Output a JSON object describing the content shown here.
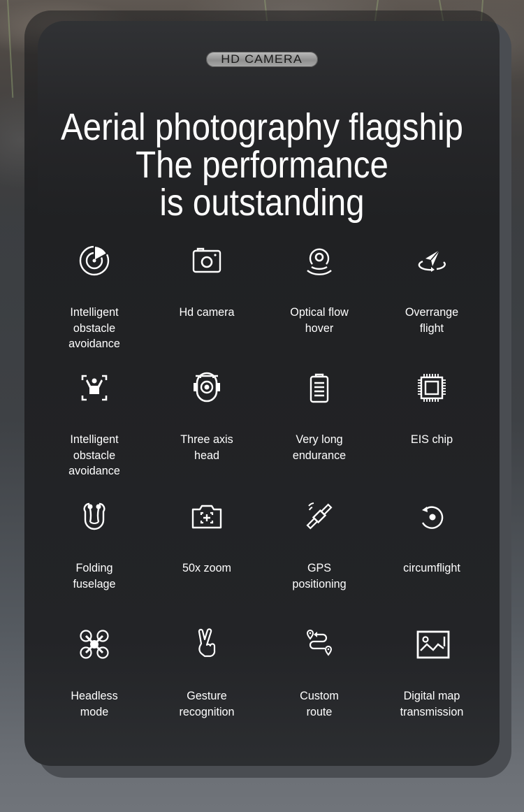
{
  "badge": {
    "label": "HD CAMERA"
  },
  "title": {
    "lines": [
      "Aerial photography flagship",
      "The performance",
      "is outstanding"
    ]
  },
  "features": [
    {
      "icon": "radar-icon",
      "label_lines": [
        "Intelligent",
        "obstacle",
        "avoidance"
      ]
    },
    {
      "icon": "camera-icon",
      "label_lines": [
        "Hd camera"
      ]
    },
    {
      "icon": "optical-flow-icon",
      "label_lines": [
        "Optical flow",
        "hover"
      ]
    },
    {
      "icon": "paper-plane-orbit-icon",
      "label_lines": [
        "Overrange",
        "flight"
      ]
    },
    {
      "icon": "person-scan-icon",
      "label_lines": [
        "Intelligent",
        "obstacle",
        "avoidance"
      ]
    },
    {
      "icon": "gimbal-camera-icon",
      "label_lines": [
        "Three axis",
        "head"
      ]
    },
    {
      "icon": "battery-icon",
      "label_lines": [
        "Very long",
        "endurance"
      ]
    },
    {
      "icon": "chip-icon",
      "label_lines": [
        "EIS chip"
      ]
    },
    {
      "icon": "folding-drone-icon",
      "label_lines": [
        "Folding",
        "fuselage"
      ]
    },
    {
      "icon": "zoom-camera-icon",
      "label_lines": [
        "50x zoom"
      ]
    },
    {
      "icon": "satellite-icon",
      "label_lines": [
        "GPS",
        "positioning"
      ]
    },
    {
      "icon": "circle-arrow-icon",
      "label_lines": [
        "circumflight"
      ]
    },
    {
      "icon": "drone-icon",
      "label_lines": [
        "Headless",
        "mode"
      ]
    },
    {
      "icon": "victory-hand-icon",
      "label_lines": [
        "Gesture",
        "recognition"
      ]
    },
    {
      "icon": "route-icon",
      "label_lines": [
        "Custom",
        "route"
      ]
    },
    {
      "icon": "image-icon",
      "label_lines": [
        "Digital map",
        "transmission"
      ]
    }
  ]
}
